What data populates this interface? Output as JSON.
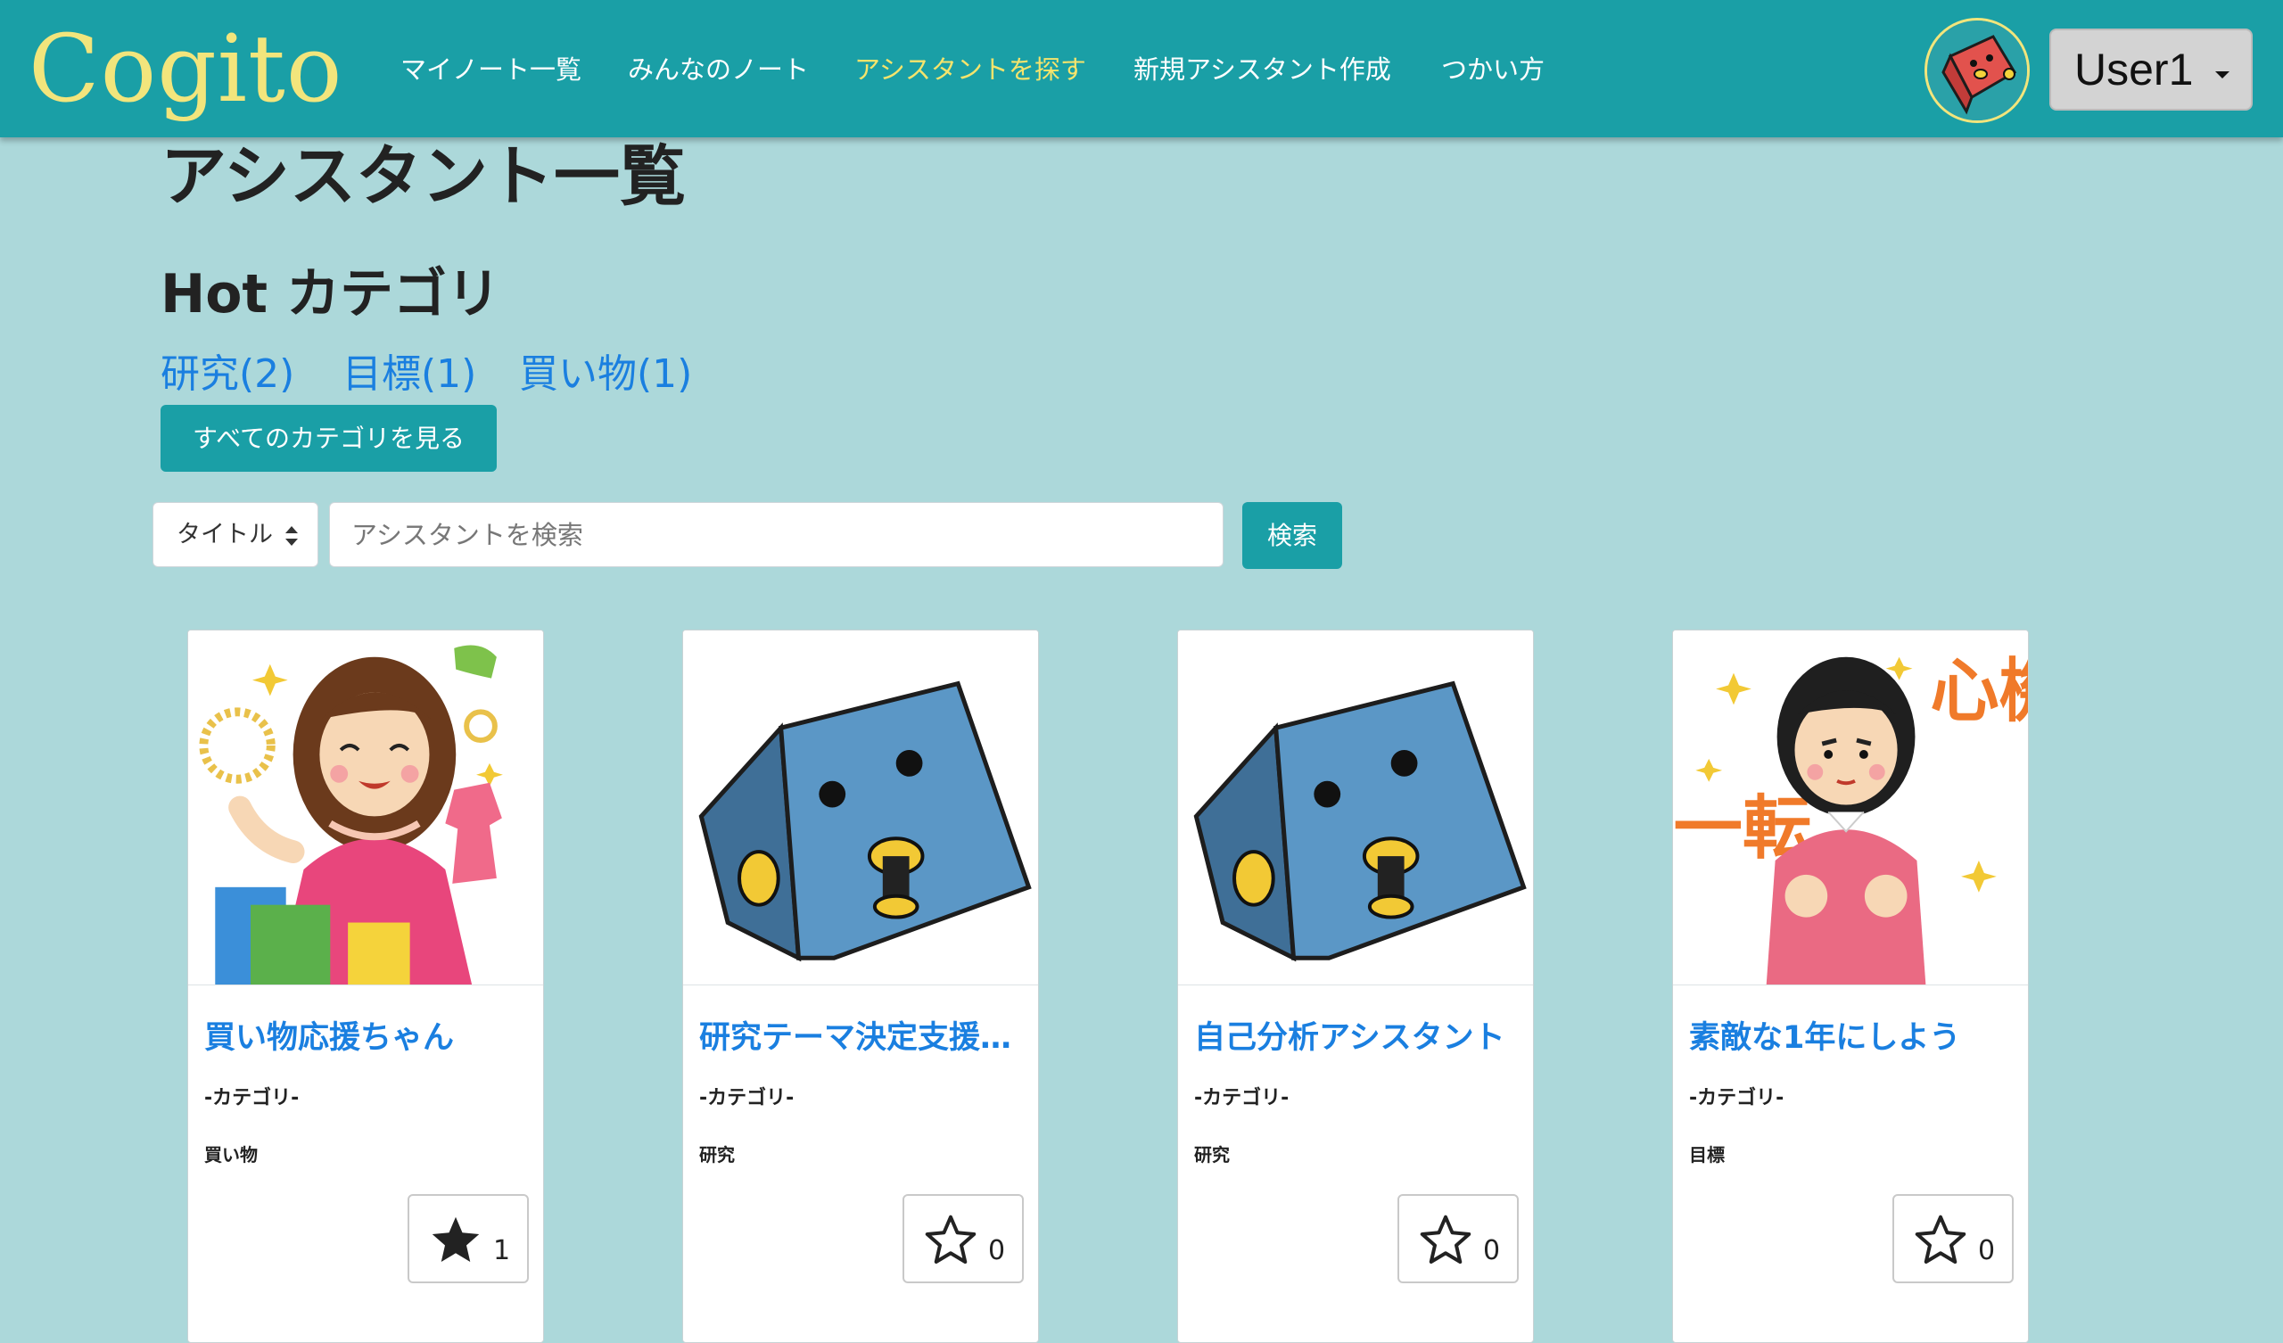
{
  "brand": {
    "name": "Cogito",
    "color": "#f2e57c"
  },
  "navbar": {
    "bg_color": "#1a9fa6",
    "links": [
      {
        "label": "マイノート一覧",
        "active": false
      },
      {
        "label": "みんなのノート",
        "active": false
      },
      {
        "label": "アシスタントを探す",
        "active": true
      },
      {
        "label": "新規アシスタント作成",
        "active": false
      },
      {
        "label": "つかい方",
        "active": false
      }
    ],
    "user": {
      "name": "User1",
      "avatar": "red-box-mascot-icon"
    }
  },
  "page": {
    "title": "アシスタント一覧",
    "bg_color": "#acd8da"
  },
  "hot_categories": {
    "heading": "Hot カテゴリ",
    "items": [
      {
        "label": "研究(2)"
      },
      {
        "label": "目標(1)"
      },
      {
        "label": "買い物(1)"
      }
    ],
    "all_button": "すべてのカテゴリを見る"
  },
  "search": {
    "select_value": "タイトル",
    "placeholder": "アシスタントを検索",
    "value": "",
    "button": "検索"
  },
  "cards": [
    {
      "title": "買い物応援ちゃん",
      "category_label": "-カテゴリ-",
      "category": "買い物",
      "favorites": "1",
      "favorited": true,
      "image": "shopping-woman-illustration"
    },
    {
      "title": "研究テーマ決定支援アシスタント",
      "category_label": "-カテゴリ-",
      "category": "研究",
      "favorites": "0",
      "favorited": false,
      "image": "blue-box-mascot-illustration"
    },
    {
      "title": "自己分析アシスタント",
      "category_label": "-カテゴリ-",
      "category": "研究",
      "favorites": "0",
      "favorited": false,
      "image": "blue-box-mascot-illustration"
    },
    {
      "title": "素敵な1年にしよう",
      "category_label": "-カテゴリ-",
      "category": "目標",
      "favorites": "0",
      "favorited": false,
      "image": "new-year-resolution-girl-illustration",
      "image_text": {
        "top": "心機",
        "left": "一転"
      }
    }
  ]
}
